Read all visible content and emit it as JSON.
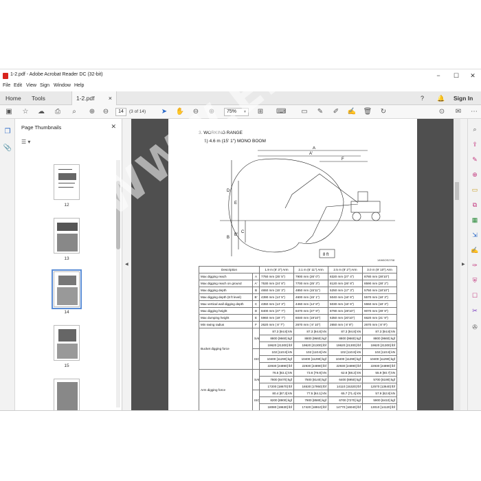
{
  "window": {
    "title": "1-2.pdf - Adobe Acrobat Reader DC (32-bit)",
    "minimize": "−",
    "maximize": "☐",
    "close": "✕"
  },
  "menu": [
    "File",
    "Edit",
    "View",
    "Sign",
    "Window",
    "Help"
  ],
  "tabs": {
    "home": "Home",
    "tools": "Tools",
    "document": "1-2.pdf",
    "document_close": "×",
    "sign_in": "Sign In"
  },
  "toolbar": {
    "page_number": "14",
    "page_count": "(3 of 14)",
    "zoom": "75%"
  },
  "thumbnails": {
    "title": "Page Thumbnails",
    "pages": [
      "12",
      "13",
      "14",
      "15"
    ],
    "selected": "14"
  },
  "document": {
    "section_title": "3. WORKING RANGE",
    "subtitle": "1) 4.6 m (15' 1\") MONO BOOM",
    "figure_code": "14W6OS2708",
    "dimension_letters": [
      "A",
      "A'",
      "F",
      "D",
      "E",
      "B",
      "B'",
      "C",
      "8 ft"
    ],
    "headers": [
      "Description",
      "",
      "1.9 m (6' 3\") Arm",
      "2.1 m (6' 11\") Arm",
      "2.5 m (8' 2\") Arm",
      "3.0 m (9' 10\") Arm"
    ],
    "rows": [
      [
        "Max digging reach",
        "A",
        "7750 mm (25' 5\")",
        "7900 mm (26' 0\")",
        "8320 mm (27' 4\")",
        "8780 mm (28'10\")"
      ],
      [
        "Max digging reach on ground",
        "A'",
        "7530 mm (24' 8\")",
        "7700 mm (25' 3\")",
        "8120 mm (26' 8\")",
        "8590 mm (28' 2\")"
      ],
      [
        "Max digging depth",
        "B",
        "4650 mm (15' 3\")",
        "4850 mm (15'11\")",
        "5250 mm (17' 3\")",
        "5750 mm (18'10\")"
      ],
      [
        "Max digging depth (8 ft level)",
        "B'",
        "4390 mm (14' 5\")",
        "4600 mm (15' 1\")",
        "5040 mm (16' 6\")",
        "5570 mm (18' 3\")"
      ],
      [
        "Max vertical wall digging depth",
        "C",
        "4350 mm (14' 3\")",
        "4460 mm (14' 8\")",
        "5030 mm (16' 6\")",
        "5550 mm (18' 3\")"
      ],
      [
        "Max digging height",
        "D",
        "8400 mm (27' 7\")",
        "8470 mm (27' 9\")",
        "8790 mm (28'10\")",
        "9070 mm (29' 9\")"
      ],
      [
        "Max dumping height",
        "E",
        "5960 mm (19' 7\")",
        "6040 mm (19'10\")",
        "6350 mm (20'10\")",
        "6620 mm (21' 9\")"
      ],
      [
        "Min  swing radius",
        "F",
        "2620 mm ( 8' 7\")",
        "2670 mm ( 8' 10\")",
        "2650 mm ( 8' 8\")",
        "2670 mm ( 8' 9\")"
      ]
    ],
    "bucket_label": "Bucket digging force",
    "bucket_rows": [
      [
        "",
        "87.3 [94.8] kN",
        "87.3 [94.8] kN",
        "87.3 [94.8] kN",
        "87.3 [94.8] kN"
      ],
      [
        "SAE",
        "8800 [9660] kgf",
        "8800 [9660] kgf",
        "8800 [9660] kgf",
        "8800 [9660] kgf"
      ],
      [
        "",
        "19620 [21300] lbf",
        "19620 [21300] lbf",
        "19620 [21300] lbf",
        "19620 [21300] lbf"
      ],
      [
        "",
        "102 [110.8] kN",
        "102 [110.8] kN",
        "102 [110.8] kN",
        "102 [110.8] kN"
      ],
      [
        "ISO",
        "10400 [11290] kgf",
        "10400 [11290] kgf",
        "10400 [11290] kgf",
        "10400 [11290] kgf"
      ],
      [
        "",
        "22930 [24890] lbf",
        "22930 [24890] lbf",
        "22930 [24890] lbf",
        "22930 [24890] lbf"
      ]
    ],
    "arm_label": "Arm digging force",
    "arm_rows": [
      [
        "",
        "76.5 [83.1] kN",
        "73.6 [79.9] kN",
        "62.8 [68.2] kN",
        "55.9 [60.7] kN"
      ],
      [
        "SAE",
        "7800 [8470] kgf",
        "7500 [8140] kgf",
        "6400 [6950] kgf",
        "5700 [6190] kgf"
      ],
      [
        "",
        "17200 [18670] lbf",
        "16530 [17950] lbf",
        "14110 [15320] lbf",
        "12570 [13640] lbf"
      ],
      [
        "",
        "80.4 [87.3] kN",
        "77.5 [84.1] kN",
        "65.7 [71.4] kN",
        "57.9 [62.8] kN"
      ],
      [
        "ISO",
        "8200 [8900] kgf",
        "7900 [8580] kgf",
        "6700 [7270] kgf",
        "5900 [6410] kgf"
      ],
      [
        "",
        "18080 [19630] lbf",
        "17420 [18910] lbf",
        "14770 [16040] lbf",
        "13010 [14120] lbf"
      ]
    ]
  },
  "watermark": "WWW.EPCDEPO.COM"
}
